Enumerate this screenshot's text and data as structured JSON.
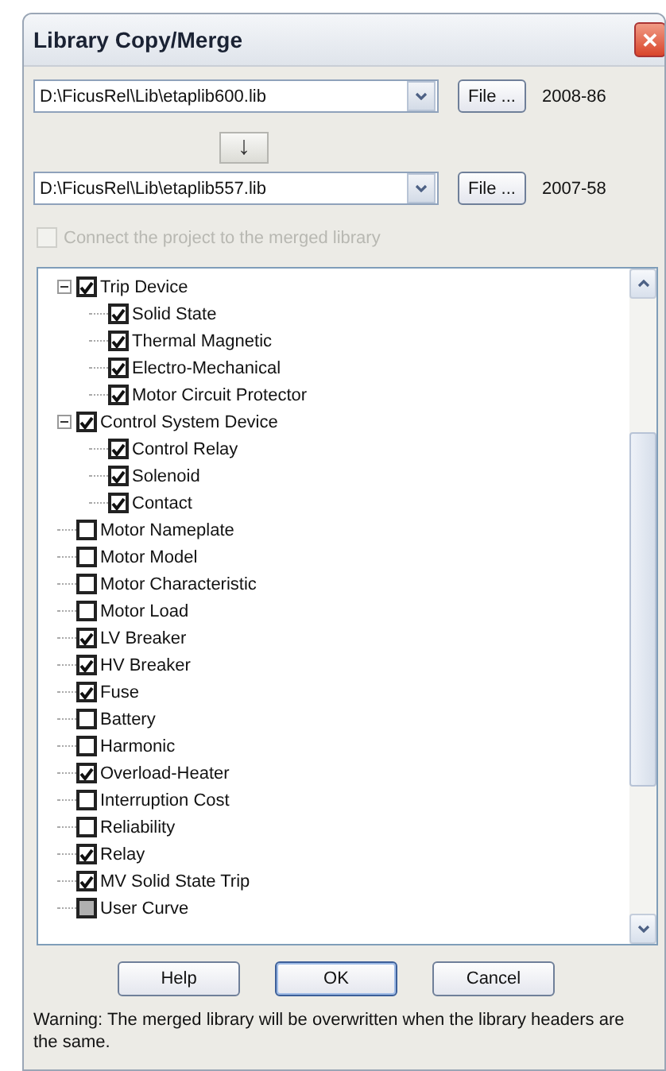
{
  "window": {
    "title": "Library Copy/Merge",
    "close": "✕"
  },
  "source": {
    "path": "D:\\FicusRel\\Lib\\etaplib600.lib",
    "button": "File ...",
    "version": "2008-86"
  },
  "copy_arrow": "↓",
  "target": {
    "path": "D:\\FicusRel\\Lib\\etaplib557.lib",
    "button": "File ...",
    "version": "2007-58"
  },
  "connect_option": {
    "label": "Connect the project to the merged library",
    "checked": false,
    "disabled": true
  },
  "tree": [
    {
      "label": "Trip Device",
      "checked": true,
      "grayed": false,
      "expanded": true,
      "children": [
        {
          "label": "Solid State",
          "checked": true,
          "grayed": false
        },
        {
          "label": "Thermal Magnetic",
          "checked": true,
          "grayed": false
        },
        {
          "label": "Electro-Mechanical",
          "checked": true,
          "grayed": false
        },
        {
          "label": "Motor Circuit Protector",
          "checked": true,
          "grayed": false
        }
      ]
    },
    {
      "label": "Control System Device",
      "checked": true,
      "grayed": false,
      "expanded": true,
      "children": [
        {
          "label": "Control Relay",
          "checked": true,
          "grayed": false
        },
        {
          "label": "Solenoid",
          "checked": true,
          "grayed": false
        },
        {
          "label": "Contact",
          "checked": true,
          "grayed": false
        }
      ]
    },
    {
      "label": "Motor Nameplate",
      "checked": false,
      "grayed": false
    },
    {
      "label": "Motor Model",
      "checked": false,
      "grayed": false
    },
    {
      "label": "Motor Characteristic",
      "checked": false,
      "grayed": false
    },
    {
      "label": "Motor Load",
      "checked": false,
      "grayed": false
    },
    {
      "label": "LV Breaker",
      "checked": true,
      "grayed": false
    },
    {
      "label": "HV Breaker",
      "checked": true,
      "grayed": false
    },
    {
      "label": "Fuse",
      "checked": true,
      "grayed": false
    },
    {
      "label": "Battery",
      "checked": false,
      "grayed": false
    },
    {
      "label": "Harmonic",
      "checked": false,
      "grayed": false
    },
    {
      "label": "Overload-Heater",
      "checked": true,
      "grayed": false
    },
    {
      "label": "Interruption Cost",
      "checked": false,
      "grayed": false
    },
    {
      "label": "Reliability",
      "checked": false,
      "grayed": false
    },
    {
      "label": "Relay",
      "checked": true,
      "grayed": false
    },
    {
      "label": "MV Solid State Trip",
      "checked": true,
      "grayed": false
    },
    {
      "label": "User Curve",
      "checked": false,
      "grayed": true
    }
  ],
  "buttons": [
    {
      "label": "Help",
      "default": false
    },
    {
      "label": "OK",
      "default": true
    },
    {
      "label": "Cancel",
      "default": false
    }
  ],
  "warning": "Warning: The merged library will be overwritten when the library headers are the same."
}
